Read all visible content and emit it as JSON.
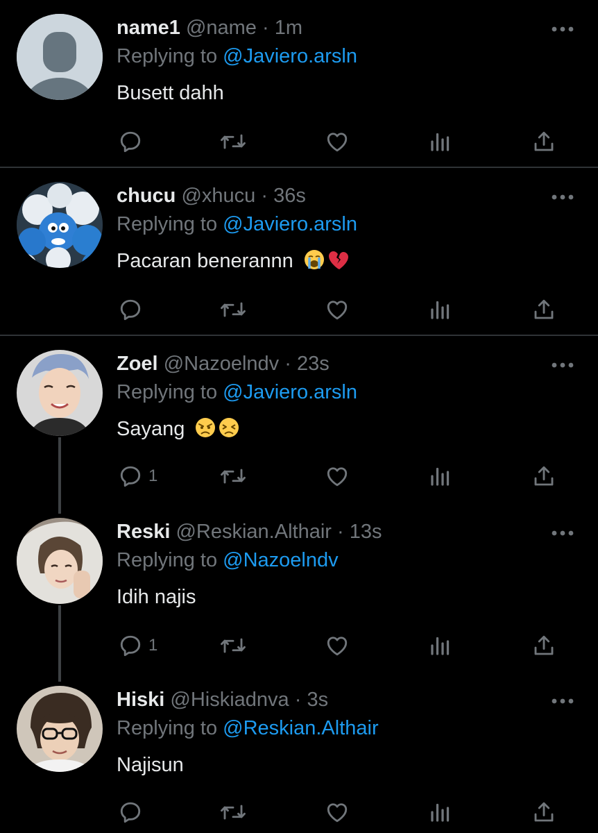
{
  "replies_label": "Replying to",
  "colors": {
    "background": "#000000",
    "text": "#e7e9ea",
    "muted": "#71767b",
    "accent": "#1d9bf0"
  },
  "tweets": [
    {
      "name": "name1",
      "handle": "@name",
      "dot": "·",
      "time": "1m",
      "reply_to": "@Javiero.arsln",
      "text": "Busett dahh",
      "emojis": [],
      "reply_count": "",
      "avatar": "default-avatar"
    },
    {
      "name": "chucu",
      "handle": "@xhucu",
      "dot": "·",
      "time": "36s",
      "reply_to": "@Javiero.arsln",
      "text": "Pacaran benerannn",
      "emojis": [
        "loudly-crying-face-emoji",
        "broken-heart-emoji"
      ],
      "reply_count": "",
      "avatar": "smurf-plush-avatar"
    },
    {
      "name": "Zoel",
      "handle": "@Nazoelndv",
      "dot": "·",
      "time": "23s",
      "reply_to": "@Javiero.arsln",
      "text": "Sayang",
      "emojis": [
        "angry-face-emoji",
        "persevering-face-emoji"
      ],
      "reply_count": "1",
      "avatar": "photo-avatar"
    },
    {
      "name": "Reski",
      "handle": "@Reskian.Althair",
      "dot": "·",
      "time": "13s",
      "reply_to": "@Nazoelndv",
      "text": "Idih najis",
      "emojis": [],
      "reply_count": "1",
      "avatar": "photo-avatar"
    },
    {
      "name": "Hiski",
      "handle": "@Hiskiadnva",
      "dot": "·",
      "time": "3s",
      "reply_to": "@Reskian.Althair",
      "text": "Najisun",
      "emojis": [],
      "reply_count": "",
      "avatar": "photo-avatar"
    }
  ],
  "icons": [
    "reply-icon",
    "retweet-icon",
    "like-icon",
    "views-icon",
    "share-icon",
    "more-icon"
  ]
}
